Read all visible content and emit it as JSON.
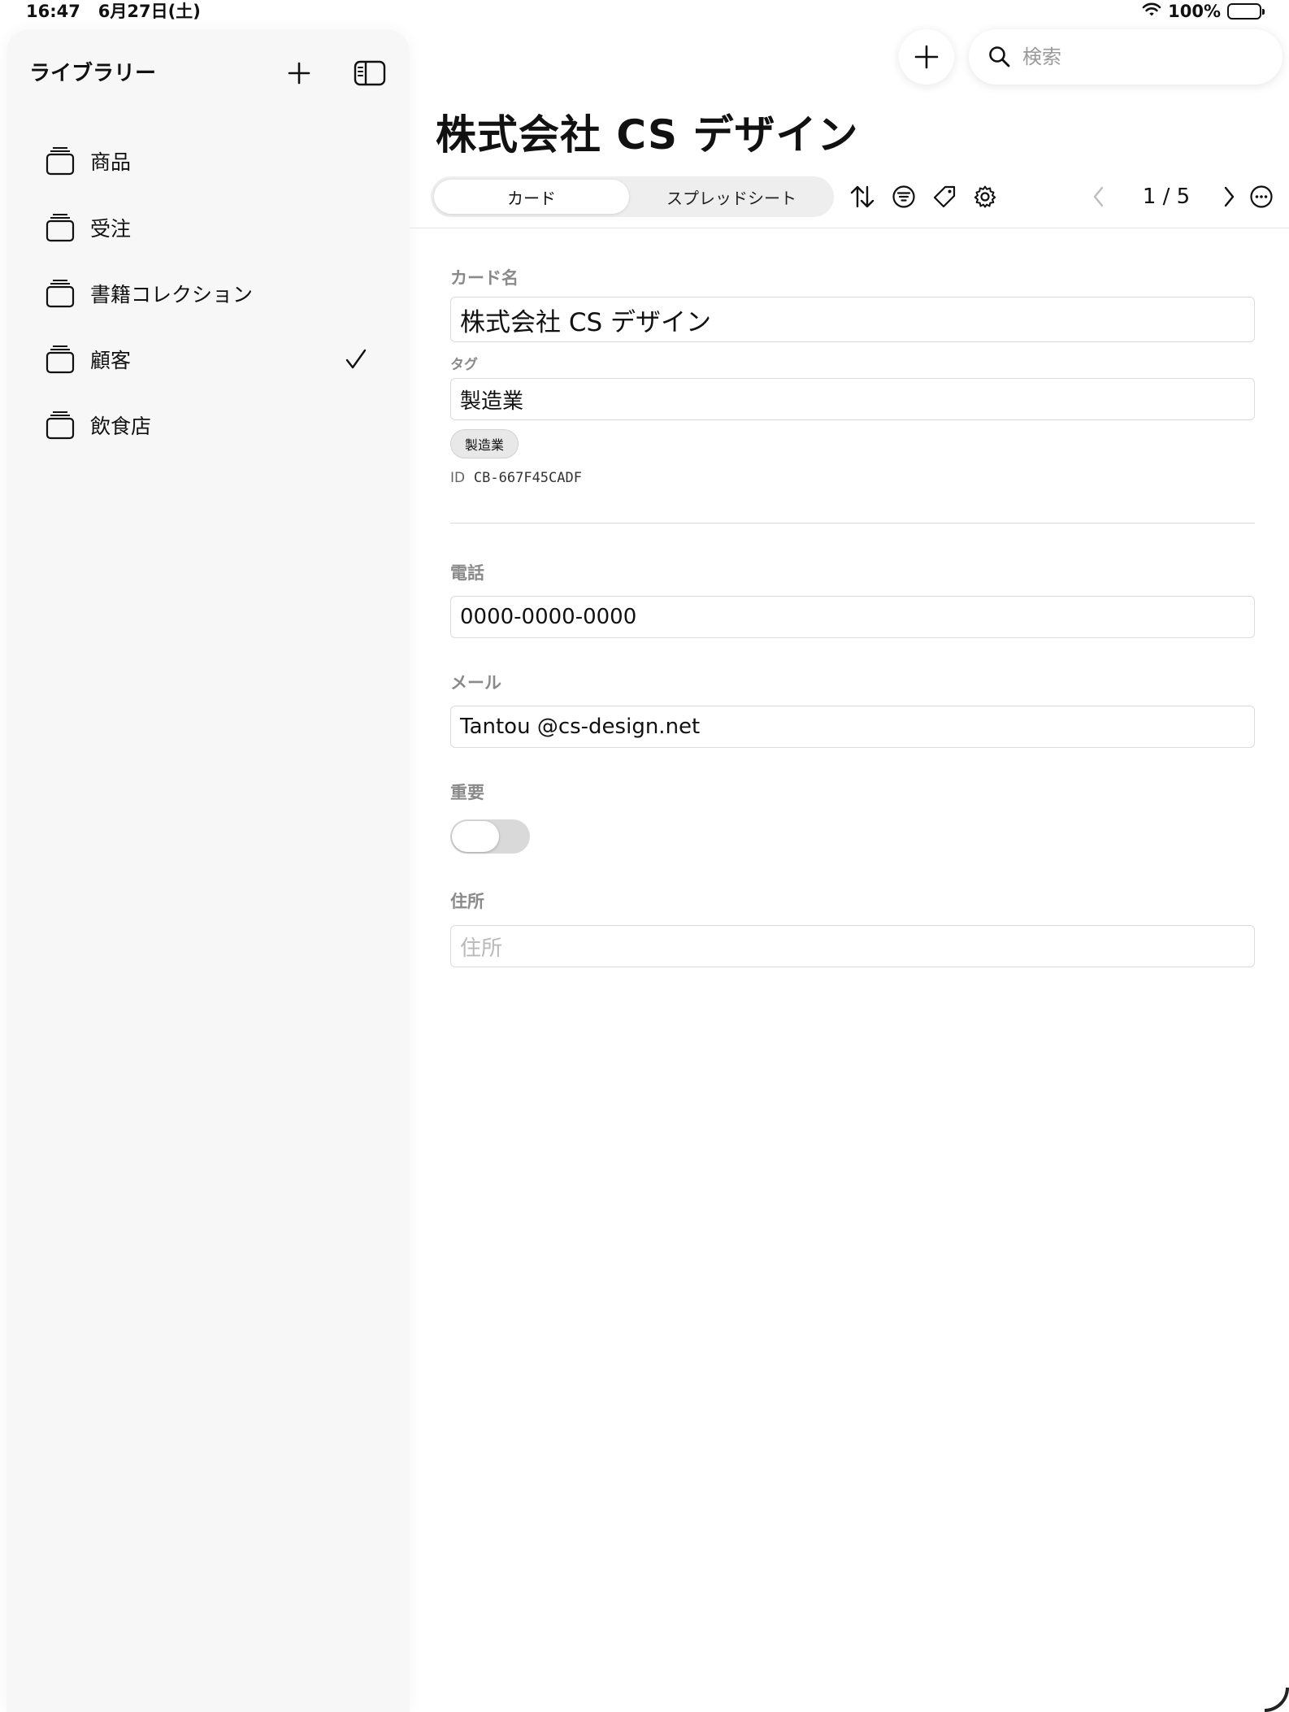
{
  "status_bar": {
    "time": "16:47",
    "date": "6月27日(土)",
    "battery": "100%"
  },
  "sidebar": {
    "title": "ライブラリー",
    "items": [
      {
        "label": "商品",
        "selected": false
      },
      {
        "label": "受注",
        "selected": false
      },
      {
        "label": "書籍コレクション",
        "selected": false
      },
      {
        "label": "顧客",
        "selected": true
      },
      {
        "label": "飲食店",
        "selected": false
      }
    ]
  },
  "search": {
    "placeholder": "検索"
  },
  "record": {
    "title": "株式会社 CS デザイン"
  },
  "view_tabs": {
    "card": "カード",
    "spreadsheet": "スプレッドシート",
    "active": "card"
  },
  "pager": {
    "text": "1 / 5"
  },
  "form": {
    "card_name_label": "カード名",
    "card_name_value": "株式会社 CS デザイン",
    "tag_label": "タグ",
    "tag_value": "製造業",
    "tag_chip": "製造業",
    "id_prefix": "ID",
    "id_value": "CB-667F45CADF",
    "phone_label": "電話",
    "phone_value": "0000-0000-0000",
    "mail_label": "メール",
    "mail_value": "Tantou @cs-design.net",
    "important_label": "重要",
    "important_on": false,
    "address_label": "住所",
    "address_placeholder": "住所"
  }
}
